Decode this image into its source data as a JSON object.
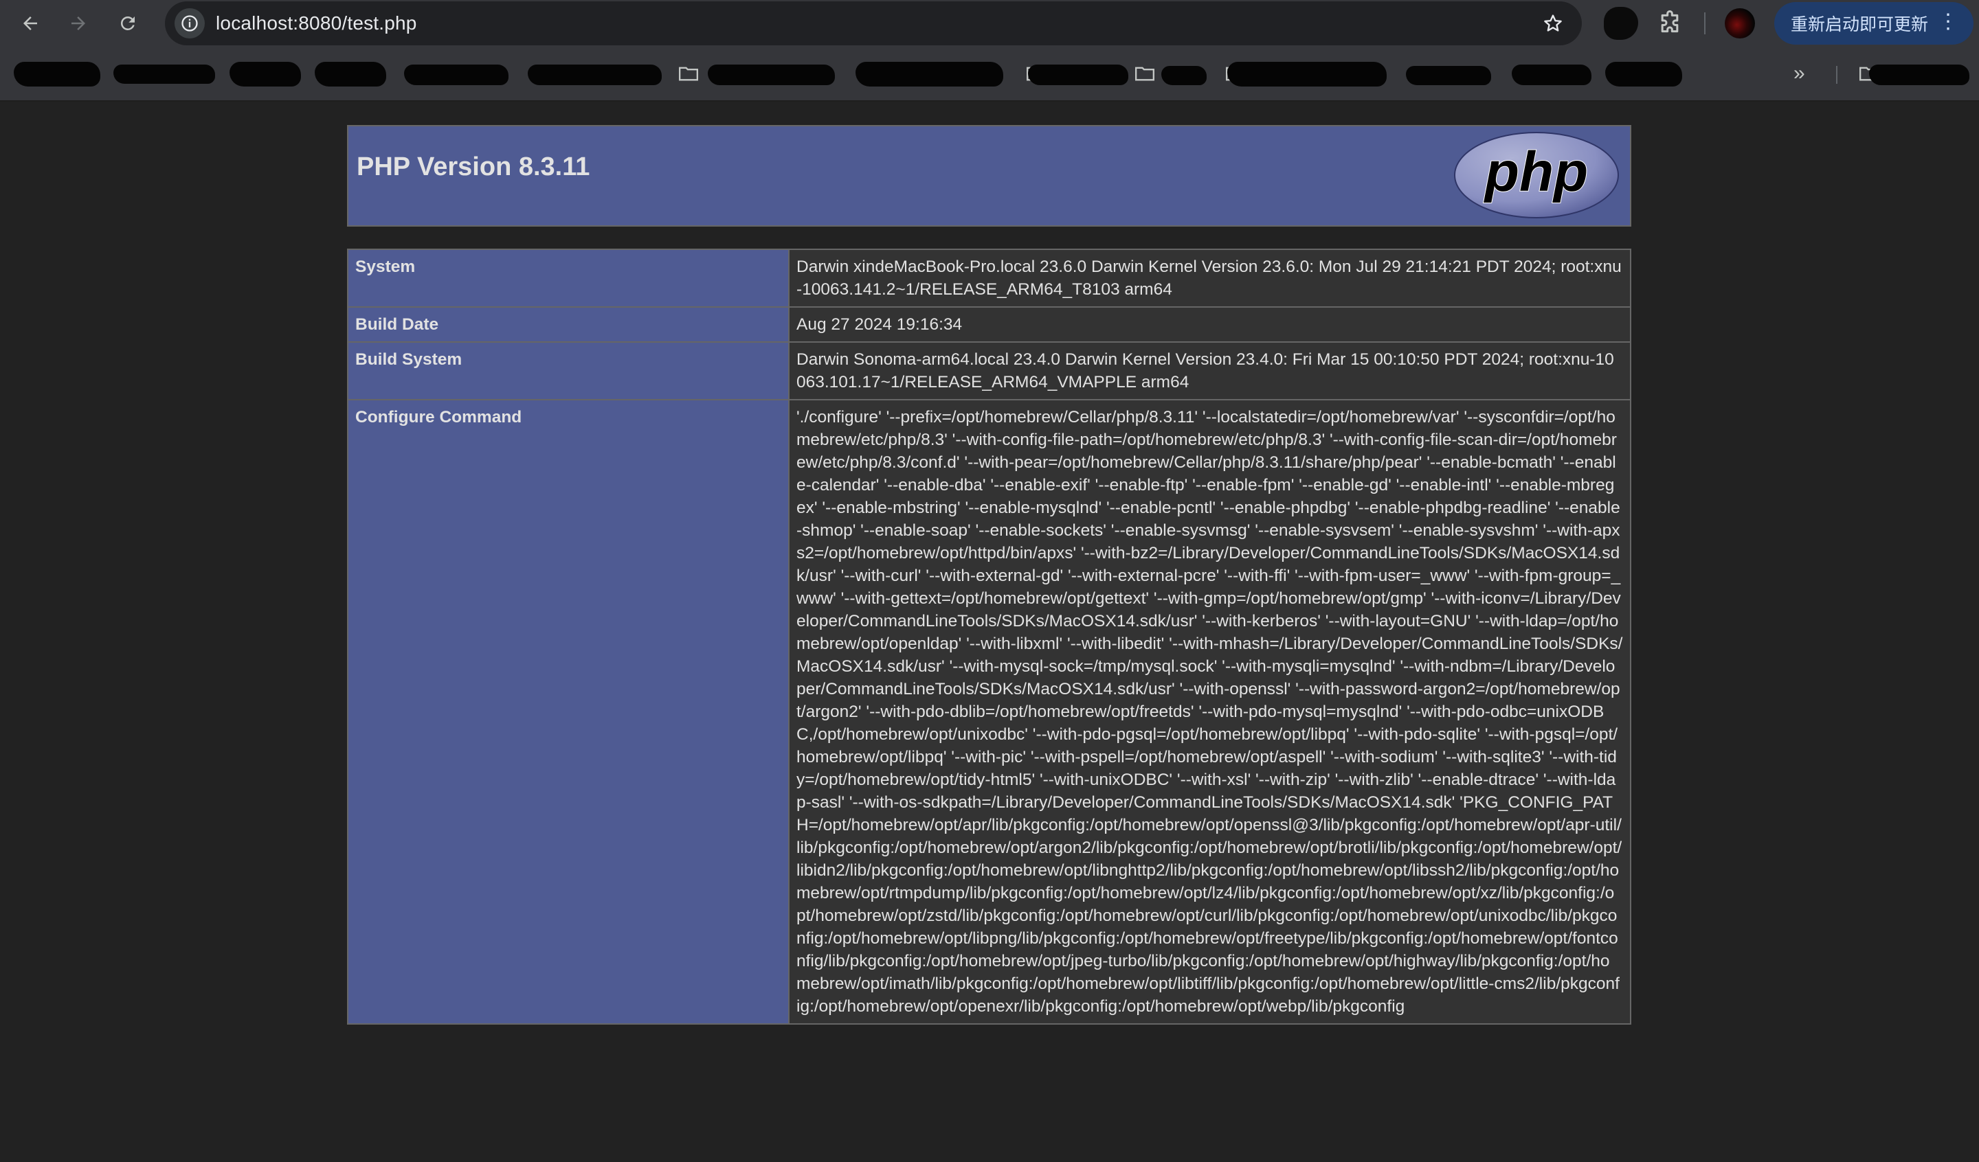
{
  "browser": {
    "url": "localhost:8080/test.php",
    "update_button_label": "重新启动即可更新",
    "icons": {
      "back": "arrow-left-icon",
      "forward": "arrow-right-icon",
      "reload": "reload-icon",
      "site_info": "info-icon",
      "bookmark_star": "star-icon",
      "extensions": "puzzle-icon",
      "menu": "kebab-menu-icon",
      "more_bookmarks": "chevron-double-right-icon"
    },
    "more_bookmarks_glyph": "»"
  },
  "phpinfo": {
    "title": "PHP Version 8.3.11",
    "logo_text": "php",
    "rows": [
      {
        "label": "System",
        "value": "Darwin xindeMacBook-Pro.local 23.6.0 Darwin Kernel Version 23.6.0: Mon Jul 29 21:14:21 PDT 2024; root:xnu-10063.141.2~1/RELEASE_ARM64_T8103 arm64"
      },
      {
        "label": "Build Date",
        "value": "Aug 27 2024 19:16:34"
      },
      {
        "label": "Build System",
        "value": "Darwin Sonoma-arm64.local 23.4.0 Darwin Kernel Version 23.4.0: Fri Mar 15 00:10:50 PDT 2024; root:xnu-10063.101.17~1/RELEASE_ARM64_VMAPPLE arm64"
      },
      {
        "label": "Configure Command",
        "value": "'./configure' '--prefix=/opt/homebrew/Cellar/php/8.3.11' '--localstatedir=/opt/homebrew/var' '--sysconfdir=/opt/homebrew/etc/php/8.3' '--with-config-file-path=/opt/homebrew/etc/php/8.3' '--with-config-file-scan-dir=/opt/homebrew/etc/php/8.3/conf.d' '--with-pear=/opt/homebrew/Cellar/php/8.3.11/share/php/pear' '--enable-bcmath' '--enable-calendar' '--enable-dba' '--enable-exif' '--enable-ftp' '--enable-fpm' '--enable-gd' '--enable-intl' '--enable-mbregex' '--enable-mbstring' '--enable-mysqlnd' '--enable-pcntl' '--enable-phpdbg' '--enable-phpdbg-readline' '--enable-shmop' '--enable-soap' '--enable-sockets' '--enable-sysvmsg' '--enable-sysvsem' '--enable-sysvshm' '--with-apxs2=/opt/homebrew/opt/httpd/bin/apxs' '--with-bz2=/Library/Developer/CommandLineTools/SDKs/MacOSX14.sdk/usr' '--with-curl' '--with-external-gd' '--with-external-pcre' '--with-ffi' '--with-fpm-user=_www' '--with-fpm-group=_www' '--with-gettext=/opt/homebrew/opt/gettext' '--with-gmp=/opt/homebrew/opt/gmp' '--with-iconv=/Library/Developer/CommandLineTools/SDKs/MacOSX14.sdk/usr' '--with-kerberos' '--with-layout=GNU' '--with-ldap=/opt/homebrew/opt/openldap' '--with-libxml' '--with-libedit' '--with-mhash=/Library/Developer/CommandLineTools/SDKs/MacOSX14.sdk/usr' '--with-mysql-sock=/tmp/mysql.sock' '--with-mysqli=mysqlnd' '--with-ndbm=/Library/Developer/CommandLineTools/SDKs/MacOSX14.sdk/usr' '--with-openssl' '--with-password-argon2=/opt/homebrew/opt/argon2' '--with-pdo-dblib=/opt/homebrew/opt/freetds' '--with-pdo-mysql=mysqlnd' '--with-pdo-odbc=unixODBC,/opt/homebrew/opt/unixodbc' '--with-pdo-pgsql=/opt/homebrew/opt/libpq' '--with-pdo-sqlite' '--with-pgsql=/opt/homebrew/opt/libpq' '--with-pic' '--with-pspell=/opt/homebrew/opt/aspell' '--with-sodium' '--with-sqlite3' '--with-tidy=/opt/homebrew/opt/tidy-html5' '--with-unixODBC' '--with-xsl' '--with-zip' '--with-zlib' '--enable-dtrace' '--with-ldap-sasl' '--with-os-sdkpath=/Library/Developer/CommandLineTools/SDKs/MacOSX14.sdk' 'PKG_CONFIG_PATH=/opt/homebrew/opt/apr/lib/pkgconfig:/opt/homebrew/opt/openssl@3/lib/pkgconfig:/opt/homebrew/opt/apr-util/lib/pkgconfig:/opt/homebrew/opt/argon2/lib/pkgconfig:/opt/homebrew/opt/brotli/lib/pkgconfig:/opt/homebrew/opt/libidn2/lib/pkgconfig:/opt/homebrew/opt/libnghttp2/lib/pkgconfig:/opt/homebrew/opt/libssh2/lib/pkgconfig:/opt/homebrew/opt/rtmpdump/lib/pkgconfig:/opt/homebrew/opt/lz4/lib/pkgconfig:/opt/homebrew/opt/xz/lib/pkgconfig:/opt/homebrew/opt/zstd/lib/pkgconfig:/opt/homebrew/opt/curl/lib/pkgconfig:/opt/homebrew/opt/unixodbc/lib/pkgconfig:/opt/homebrew/opt/libpng/lib/pkgconfig:/opt/homebrew/opt/freetype/lib/pkgconfig:/opt/homebrew/opt/fontconfig/lib/pkgconfig:/opt/homebrew/opt/jpeg-turbo/lib/pkgconfig:/opt/homebrew/opt/highway/lib/pkgconfig:/opt/homebrew/opt/imath/lib/pkgconfig:/opt/homebrew/opt/libtiff/lib/pkgconfig:/opt/homebrew/opt/little-cms2/lib/pkgconfig:/opt/homebrew/opt/openexr/lib/pkgconfig:/opt/homebrew/opt/webp/lib/pkgconfig"
      }
    ]
  }
}
